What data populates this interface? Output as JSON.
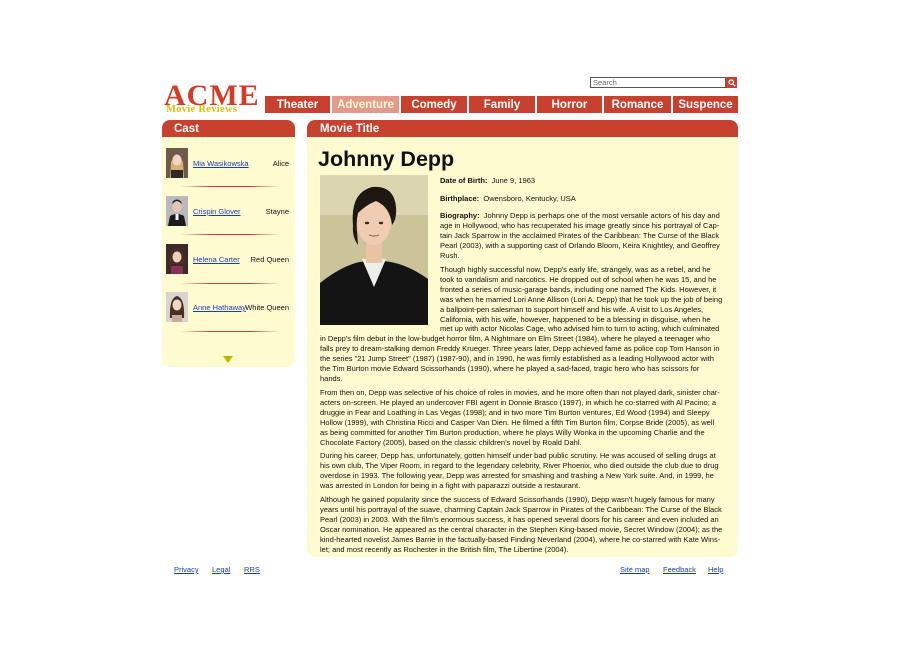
{
  "search": {
    "placeholder": "Search"
  },
  "logo": {
    "title": "ACME",
    "subtitle": "Movie Reviews"
  },
  "nav": {
    "tabs": [
      "Theater",
      "Adventure",
      "Comedy",
      "Family",
      "Horror",
      "Romance",
      "Suspence"
    ],
    "active": "Adventure"
  },
  "sidebar": {
    "title": "Cast",
    "cast": [
      {
        "actor": "Mia Wasikowska",
        "role": "Alice"
      },
      {
        "actor": "Crispin Glover",
        "role": "Stayne"
      },
      {
        "actor": "Helena Carter",
        "role": "Red Queen"
      },
      {
        "actor": "Anne Hathaway",
        "role": "White Queen"
      }
    ]
  },
  "main": {
    "title": "Movie Title",
    "actor_name": "Johnny Depp",
    "dob_label": "Date of Birth:",
    "dob": "June 9, 1963",
    "birthplace_label": "Birthplace:",
    "birthplace": "Owensboro, Kentucky, USA",
    "bio_label": "Biography:",
    "bio_lines": [
      "Johnny Depp is perhaps one of the most versatile actors of his day and",
      "age in Hollywood, who has recuperated his image greatly since his portrayal of Cap-",
      "tain Jack Sparrow in the acclaimed Pirates of the Caribbean: The Curse of the Black",
      "Pearl (2003), with a supporting cast of Orlando Bloom, Keira Knightley, and Geoffrey",
      "Rush."
    ],
    "para2_lines": [
      "Though highly successful now, Depp's early life, strangely, was as a rebel, and he",
      "took to vandalism and narcotics. He dropped out of school when he was 15, and he",
      "fronted a series of music-garage bands, including one named The Kids. However, it",
      "was when he married Lori Anne Allison (Lori A. Depp) that he took up the job of being",
      "a ballpoint-pen salesman to support himself and his wife. A visit to Los Angeles,",
      "California, with his wife, however, happened to be a blessing in disguise, when he",
      "met up with actor Nicolas Cage, who advised him to turn to acting, which culminated"
    ],
    "para3_lines": [
      "in Depp's film debut in the low-budget horror film, A Nightmare on Elm Street (1984), where he played a teenager who",
      "falls prey to dream-stalking demon Freddy Krueger. Three years later, Depp achieved fame as police cop Tom Hanson in",
      "the series \"21 Jump Street\" (1987) (1987-90), and in 1990, he was firmly established as a leading Hollywood actor with",
      "the Tim Burton movie Edward Scissorhands (1990), where he played a sad-faced, tragic hero who has scissors for",
      "hands."
    ],
    "para4_lines": [
      "From then on, Depp was selective of his choice of roles in movies, and he more often than not played dark, sinister char-",
      "acters on-screen. He played an undercover FBI agent in Donnie Brasco (1997), in which he co-starred with Al Pacino; a",
      "druggie in Fear and Loathing in Las Vegas (1998); and in two more Tim Burton ventures, Ed Wood (1994) and Sleepy",
      "Hollow (1999), with Christina Ricci and Casper Van Dien. He filmed a fifth Tim Burton film, Corpse Bride (2005), as well",
      "as being committed for another Tim Burton production, where he plays Willy Wonka in the upcoming Charlie and the",
      "Chocolate Factory (2005), based on the classic children's novel by Roald Dahl."
    ],
    "para5_lines": [
      "During his career, Depp has, unfortunately, gotten himself under bad public scrutiny. He was accused of selling drugs at",
      "his own club, The Viper Room, in regard to the legendary celebrity, River Phoenix, who died outside the club due to drug",
      "overdose in 1993. The following year, Depp was arrested for smashing and trashing a New York suite. And, in 1999, he",
      "was arrested in London for being in a fight with paparazzi outside a restaurant."
    ],
    "para6_lines": [
      "Although he gained popularity since the success of Edward Scissorhands (1990), Depp wasn't hugely famous for many",
      "years until his portrayal of the suave, charming Captain Jack Sparrow in Pirates of the Caribbean: The Curse of the Black",
      "Pearl (2003) in 2003. With the film's enormous success, it has opened several doors for his career and even included an",
      "Oscar nomination. He appeared as the central character in the Stephen King-based movie, Secret Window (2004); as the",
      "kind-hearted novelist James Barrie in the factually-based Finding Neverland (2004), where he co-starred with Kate Wins-",
      "let; and most recently as Rochester in the British film, The Libertine (2004)."
    ]
  },
  "footer": {
    "left": [
      "Privacy",
      "Legal",
      "RRS"
    ],
    "right": [
      "Site map",
      "Feedback",
      "Help"
    ]
  },
  "colors": {
    "accent": "#c8412e",
    "panel": "#fdfbcf",
    "logo_red": "#d63b28",
    "logo_yellow": "#d6c400",
    "link": "#1a3cb8"
  },
  "icons": {
    "search": "magnifier-icon",
    "scroll": "triangle-down-icon"
  }
}
